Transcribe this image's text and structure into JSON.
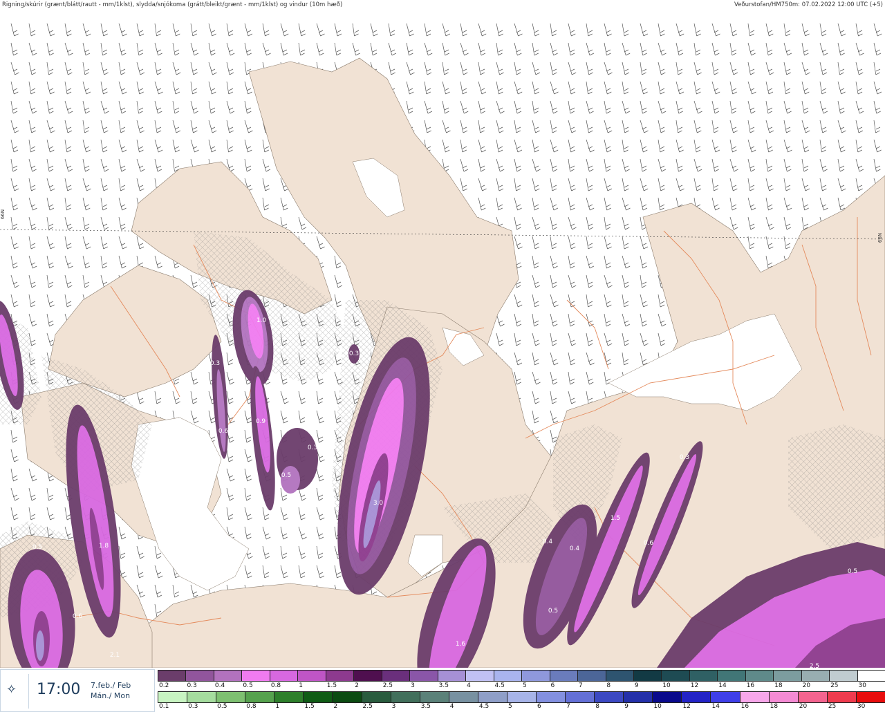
{
  "header": {
    "title": "Rigning/skúrir (grænt/blátt/rautt - mm/1klst), slydda/snjókoma (grátt/bleikt/grænt - mm/1klst) og vindur (10m hæð)",
    "source": "Veðurstofan/HM750m: 07.02.2022 12:00 UTC (+5)"
  },
  "map": {
    "lat_label": "66N",
    "colors": {
      "land": "#f1e2d4",
      "sea": "#ffffff",
      "roads": "#e48a5c",
      "wind": "#555555"
    },
    "values": [
      {
        "text": "1.0",
        "color": "#ffffff"
      },
      {
        "text": "0.3",
        "color": "#ffffff"
      },
      {
        "text": "0.6",
        "color": "#ffffff"
      },
      {
        "text": "0.9",
        "color": "#ffffff"
      },
      {
        "text": "0.3",
        "color": "#ffffff"
      },
      {
        "text": "0.5",
        "color": "#ffffff"
      },
      {
        "text": "0.3",
        "color": "#ffffff"
      },
      {
        "text": "3.0",
        "color": "#ffffff"
      },
      {
        "text": "0.5",
        "color": "#ffffff"
      },
      {
        "text": "1.8",
        "color": "#ffffff"
      },
      {
        "text": "0.6",
        "color": "#ffffff"
      },
      {
        "text": "2.1",
        "color": "#ffffff"
      },
      {
        "text": "1.6",
        "color": "#ffffff"
      },
      {
        "text": "0.4",
        "color": "#ffffff"
      },
      {
        "text": "0.4",
        "color": "#ffffff"
      },
      {
        "text": "1.5",
        "color": "#ffffff"
      },
      {
        "text": "0.6",
        "color": "#ffffff"
      },
      {
        "text": "0.3",
        "color": "#ffffff"
      },
      {
        "text": "0.5",
        "color": "#ffffff"
      },
      {
        "text": "0.5",
        "color": "#ffffff"
      },
      {
        "text": "2.5",
        "color": "#ffffff"
      }
    ]
  },
  "time": {
    "clock": "17:00",
    "date_line1": "7.feb./ Feb",
    "date_line2": "Mán./ Mon",
    "icon": "weather-icon"
  },
  "legend": {
    "snow": {
      "labels": [
        "0.2",
        "0.3",
        "0.4",
        "0.5",
        "0.8",
        "1",
        "1.5",
        "2",
        "2.5",
        "3",
        "3.5",
        "4",
        "4.5",
        "5",
        "6",
        "7",
        "8",
        "9",
        "10",
        "12",
        "14",
        "16",
        "18",
        "20",
        "25",
        "30"
      ],
      "colors": [
        "#6b3d6b",
        "#91559c",
        "#b272be",
        "#f07bf0",
        "#d768e0",
        "#bf55c6",
        "#8d3a8f",
        "#4f0f4f",
        "#6a2f7c",
        "#8a56a8",
        "#a690d6",
        "#c1c1f4",
        "#a9b4ee",
        "#8f98dc",
        "#6a7cbc",
        "#4c6698",
        "#2e5470",
        "#123a44",
        "#1e4b53",
        "#2f6064",
        "#417677",
        "#5f8a8a",
        "#7c9c9f",
        "#98aeb1",
        "#c0ccd0",
        "#ffffff"
      ]
    },
    "rain": {
      "labels": [
        "0.1",
        "0.3",
        "0.5",
        "0.8",
        "1",
        "1.5",
        "2",
        "2.5",
        "3",
        "3.5",
        "4",
        "4.5",
        "5",
        "6",
        "7",
        "8",
        "9",
        "10",
        "12",
        "14",
        "16",
        "18",
        "20",
        "25",
        "30"
      ],
      "colors": [
        "#c8f4c2",
        "#a5dc9e",
        "#7ec071",
        "#56a24e",
        "#2e7f2b",
        "#105c15",
        "#0c4b12",
        "#2a5c3e",
        "#426f5b",
        "#5b8179",
        "#7891a1",
        "#8f9fc8",
        "#a7b4e8",
        "#8390e0",
        "#6470d6",
        "#3c49c2",
        "#2430a9",
        "#0a0a8c",
        "#2323c6",
        "#3f3fe8",
        "#f7a7ea",
        "#f48bd4",
        "#f3648f",
        "#ef3b4e",
        "#e80d0d"
      ]
    }
  }
}
